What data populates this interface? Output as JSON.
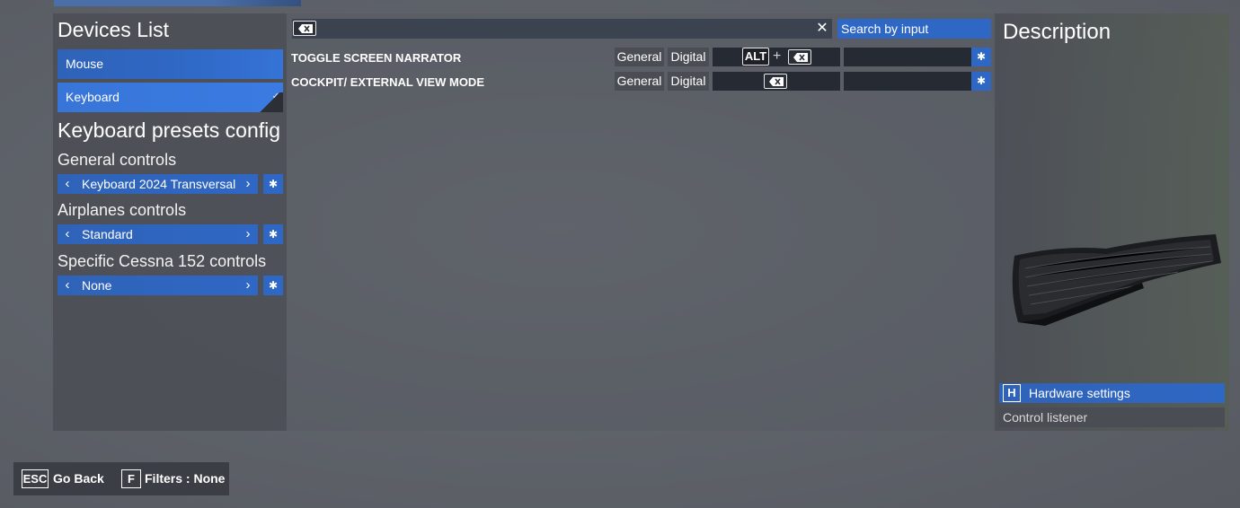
{
  "left": {
    "devices_title": "Devices List",
    "devices": [
      {
        "label": "Mouse"
      },
      {
        "label": "Keyboard"
      }
    ],
    "presets_title": "Keyboard presets config",
    "groups": [
      {
        "title": "General controls",
        "value": "Keyboard 2024 Transversal"
      },
      {
        "title": "Airplanes controls",
        "value": "Standard"
      },
      {
        "title": "Specific Cessna 152 controls",
        "value": "None"
      }
    ]
  },
  "middle": {
    "search_clear_glyph": "✕",
    "search_button": "Search by input",
    "rows": [
      {
        "name": "TOGGLE SCREEN NARRATOR",
        "category": "General",
        "type": "Digital",
        "key1": "ALT",
        "plus": "+"
      },
      {
        "name": "COCKPIT/ EXTERNAL VIEW MODE",
        "category": "General",
        "type": "Digital"
      }
    ]
  },
  "right": {
    "title": "Description",
    "hardware_key": "H",
    "hardware_label": "Hardware settings",
    "listener_label": "Control listener"
  },
  "bottom": {
    "back_key": "ESC",
    "back_label": "Go Back",
    "filter_key": "F",
    "filter_label": "Filters : None"
  },
  "colors": {
    "accent": "#2f67c4",
    "panel": "#4a4d54",
    "binding_bg": "#262a32"
  },
  "icons": {
    "backspace": "backspace-icon",
    "gear": "gear-icon",
    "chevron_left": "chevron-left-icon",
    "chevron_right": "chevron-right-icon",
    "check": "check-icon",
    "keyboard_image": "keyboard-image"
  }
}
